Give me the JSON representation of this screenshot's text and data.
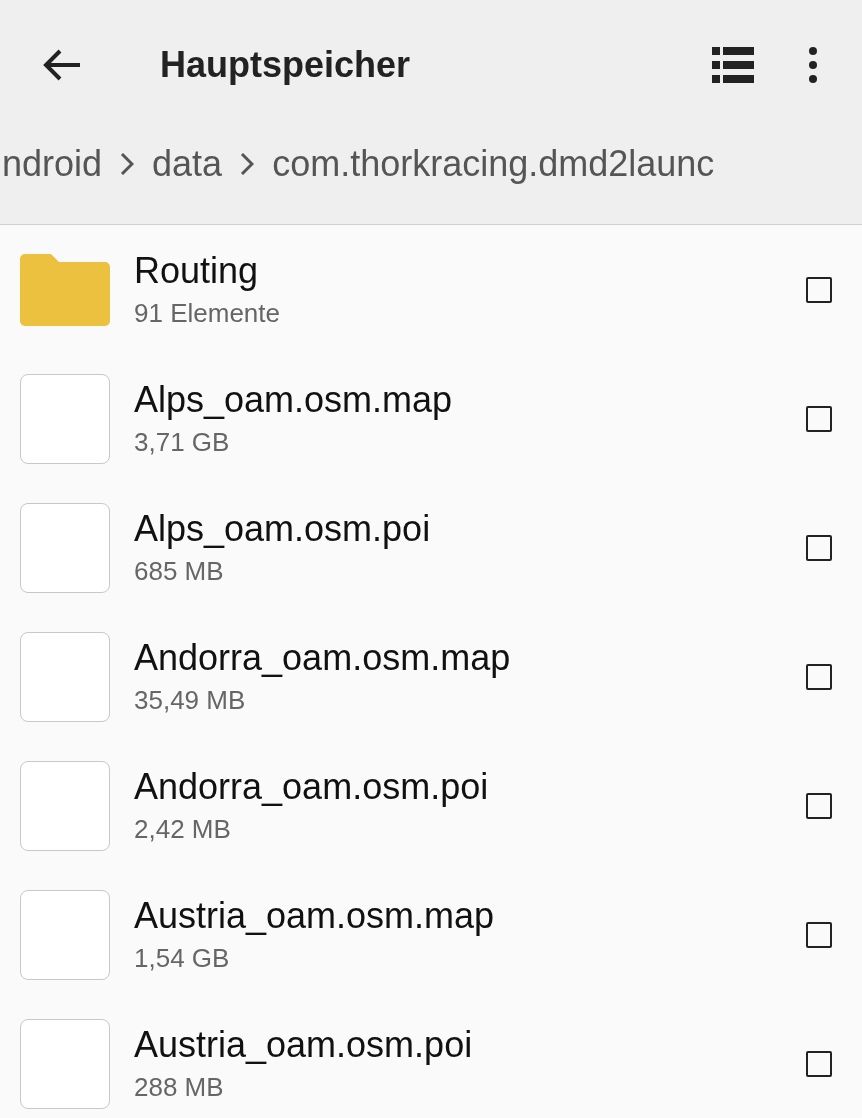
{
  "app_bar": {
    "title": "Hauptspeicher"
  },
  "breadcrumb": [
    "ndroid",
    "data",
    "com.thorkracing.dmd2launc"
  ],
  "items": [
    {
      "kind": "folder",
      "name": "Routing",
      "detail": "91 Elemente",
      "checked": false
    },
    {
      "kind": "file",
      "name": "Alps_oam.osm.map",
      "detail": "3,71 GB",
      "checked": false
    },
    {
      "kind": "file",
      "name": "Alps_oam.osm.poi",
      "detail": "685 MB",
      "checked": false
    },
    {
      "kind": "file",
      "name": "Andorra_oam.osm.map",
      "detail": "35,49 MB",
      "checked": false
    },
    {
      "kind": "file",
      "name": "Andorra_oam.osm.poi",
      "detail": "2,42 MB",
      "checked": false
    },
    {
      "kind": "file",
      "name": "Austria_oam.osm.map",
      "detail": "1,54 GB",
      "checked": false
    },
    {
      "kind": "file",
      "name": "Austria_oam.osm.poi",
      "detail": "288 MB",
      "checked": false
    }
  ]
}
